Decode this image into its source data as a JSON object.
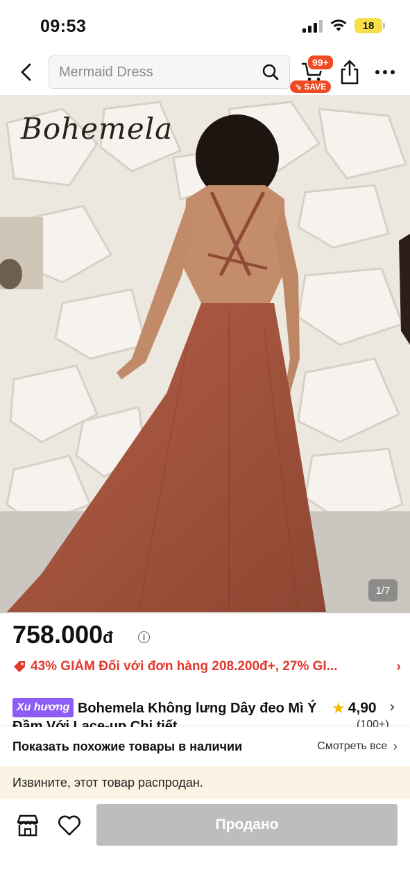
{
  "status_bar": {
    "time": "09:53",
    "battery": "18",
    "icons": [
      "signal-icon",
      "wifi-icon",
      "battery-icon"
    ]
  },
  "nav": {
    "back_icon": "chevron-left-icon",
    "search_placeholder": "Mermaid Dress",
    "cart_badge": "99+",
    "save_badge": "SAVE",
    "icons": [
      "search-icon",
      "cart-icon",
      "share-icon",
      "more-icon"
    ]
  },
  "gallery": {
    "brand_logo": "Bohemela",
    "page_indicator": "1/7"
  },
  "product": {
    "price_value": "758.000",
    "price_currency": "đ",
    "promo_text": "43% GIẢM Đối với đơn hàng 208.200đ+,  27% GI...",
    "trend_badge": "Xu hương",
    "title": "Bohemela Không lưng Dây đeo Mì Ý  Đầm Với Lace-up Chi tiết",
    "rating": "4,90",
    "rating_count": "(100+)"
  },
  "similar": {
    "title": "Показать похожие товары в наличии",
    "link": "Смотреть все"
  },
  "notice": {
    "text": "Извините, этот товар распродан."
  },
  "bottom_bar": {
    "sold_label": "Продано",
    "icons": [
      "store-icon",
      "heart-icon"
    ]
  },
  "colors": {
    "accent_red": "#f04a25",
    "promo_red": "#e2392f",
    "trend_purple": "#8b5cf6",
    "star_yellow": "#f6b800",
    "notice_bg": "#fbf3e4",
    "disabled_button": "#bdbdbd",
    "dress": "#a8563f"
  }
}
